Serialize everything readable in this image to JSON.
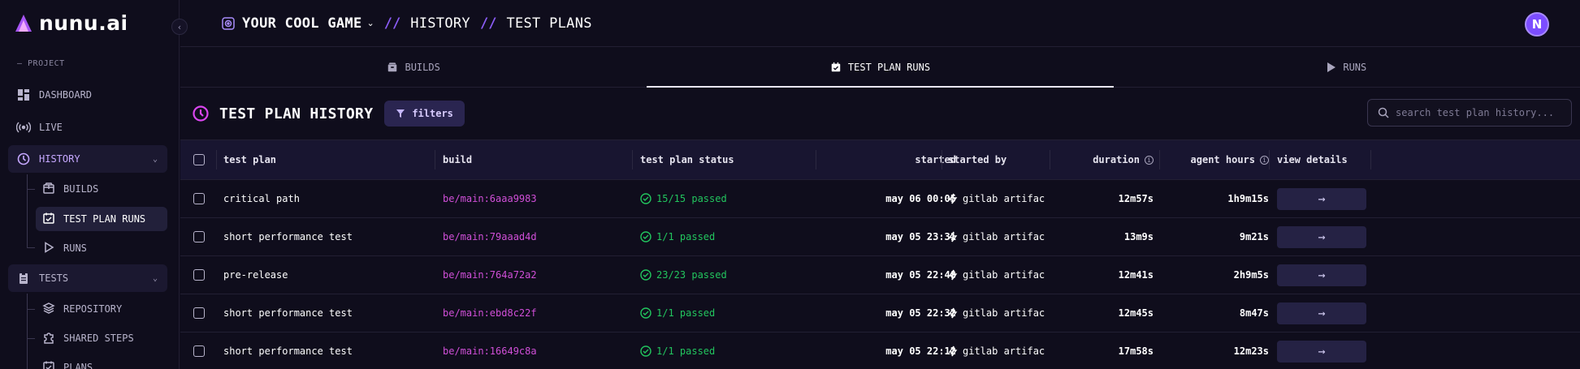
{
  "brand": {
    "name": "nunu.ai",
    "accent": "#a855f7"
  },
  "sidebar": {
    "section_label": "— PROJECT",
    "items": [
      {
        "label": "DASHBOARD",
        "icon": "dashboard-icon"
      },
      {
        "label": "LIVE",
        "icon": "broadcast-icon"
      },
      {
        "label": "HISTORY",
        "icon": "history-icon",
        "expanded": true,
        "children": [
          {
            "label": "BUILDS",
            "icon": "package-icon"
          },
          {
            "label": "TEST PLAN RUNS",
            "icon": "calendar-check-icon",
            "active": true
          },
          {
            "label": "RUNS",
            "icon": "play-icon"
          }
        ]
      },
      {
        "label": "TESTS",
        "icon": "clipboard-icon",
        "expanded": true,
        "children": [
          {
            "label": "REPOSITORY",
            "icon": "layers-icon"
          },
          {
            "label": "SHARED STEPS",
            "icon": "puzzle-icon"
          },
          {
            "label": "PLANS",
            "icon": "calendar-check-icon"
          }
        ]
      }
    ]
  },
  "breadcrumb": {
    "game": "YOUR COOL GAME",
    "sep": "//",
    "section": "HISTORY",
    "page": "TEST PLANS"
  },
  "user": {
    "initial": "N"
  },
  "tabs": [
    {
      "label": "BUILDS",
      "icon": "package-icon"
    },
    {
      "label": "TEST PLAN RUNS",
      "icon": "calendar-check-icon",
      "active": true
    },
    {
      "label": "RUNS",
      "icon": "play-icon"
    }
  ],
  "history": {
    "title": "TEST PLAN HISTORY",
    "filters_label": "filters",
    "search_placeholder": "search test plan history..."
  },
  "table": {
    "columns": {
      "test_plan": "test plan",
      "build": "build",
      "status": "test plan status",
      "started": "started",
      "started_by": "started by",
      "duration": "duration",
      "agent_hours": "agent hours",
      "view_details": "view details"
    },
    "rows": [
      {
        "plan": "critical path",
        "build": "be/main:6aaa9983",
        "status": "15/15 passed",
        "started": "may 06 00:05",
        "by": "gitlab artifac",
        "duration": "12m57s",
        "agent": "1h9m15s"
      },
      {
        "plan": "short performance test",
        "build": "be/main:79aaad4d",
        "status": "1/1 passed",
        "started": "may 05 23:31",
        "by": "gitlab artifac",
        "duration": "13m9s",
        "agent": "9m21s"
      },
      {
        "plan": "pre-release",
        "build": "be/main:764a72a2",
        "status": "23/23 passed",
        "started": "may 05 22:48",
        "by": "gitlab artifac",
        "duration": "12m41s",
        "agent": "2h9m5s"
      },
      {
        "plan": "short performance test",
        "build": "be/main:ebd8c22f",
        "status": "1/1 passed",
        "started": "may 05 22:32",
        "by": "gitlab artifac",
        "duration": "12m45s",
        "agent": "8m47s"
      },
      {
        "plan": "short performance test",
        "build": "be/main:16649c8a",
        "status": "1/1 passed",
        "started": "may 05 22:12",
        "by": "gitlab artifac",
        "duration": "17m58s",
        "agent": "12m23s"
      }
    ]
  }
}
